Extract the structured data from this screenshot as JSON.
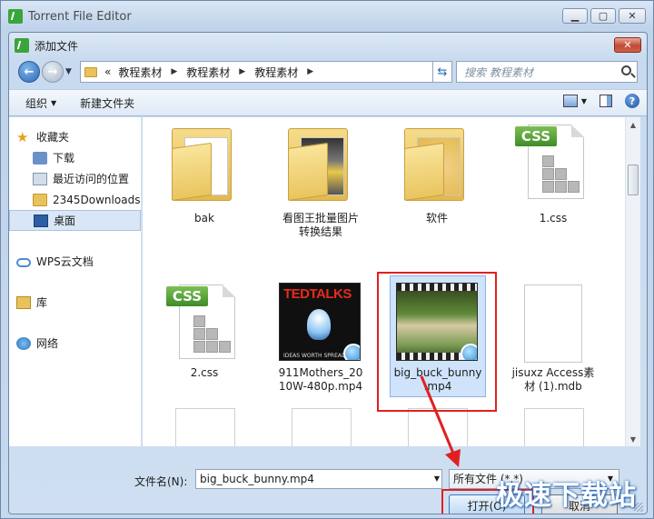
{
  "window": {
    "title": "Torrent File Editor"
  },
  "dialog": {
    "title": "添加文件"
  },
  "address": {
    "overflow": "«",
    "segments": [
      "教程素材",
      "教程素材",
      "教程素材"
    ]
  },
  "search": {
    "placeholder": "搜索 教程素材"
  },
  "toolbar": {
    "organize": "组织",
    "new_folder": "新建文件夹"
  },
  "sidebar": {
    "favorites": {
      "label": "收藏夹",
      "items": [
        "下载",
        "最近访问的位置",
        "2345Downloads",
        "桌面"
      ]
    },
    "cloud": "WPS云文档",
    "library": "库",
    "network": "网络"
  },
  "files": [
    {
      "name": "bak",
      "type": "folder"
    },
    {
      "name": "看图王批量图片转换结果",
      "line1": "看图王批量图片",
      "line2": "转换结果",
      "type": "folder-image"
    },
    {
      "name": "软件",
      "type": "folder-software"
    },
    {
      "name": "1.css",
      "type": "css"
    },
    {
      "name": "2.css",
      "type": "css"
    },
    {
      "name": "911Mothers_2010W-480p.mp4",
      "line1": "911Mothers_20",
      "line2": "10W-480p.mp4",
      "type": "video",
      "thumb_text": "TEDTALKS",
      "thumb_sub": "IDEAS WORTH SPREADING"
    },
    {
      "name": "big_buck_bunny.mp4",
      "line1": "big_buck_bunny",
      "line2": ".mp4",
      "type": "video",
      "selected": true
    },
    {
      "name": "jisuxz Access素材 (1).mdb",
      "line1": "jisuxz Access素",
      "line2": "材 (1).mdb",
      "type": "mdb"
    }
  ],
  "bottom": {
    "filename_label": "文件名(N):",
    "filename_value": "big_buck_bunny.mp4",
    "filter_value": "所有文件 (*.*)",
    "open_label": "打开(O)",
    "cancel_label": "取消"
  },
  "watermark": "极速下载站",
  "colors": {
    "highlight": "#e02020",
    "selection": "#cfe3fb",
    "accent": "#2a69b5"
  }
}
